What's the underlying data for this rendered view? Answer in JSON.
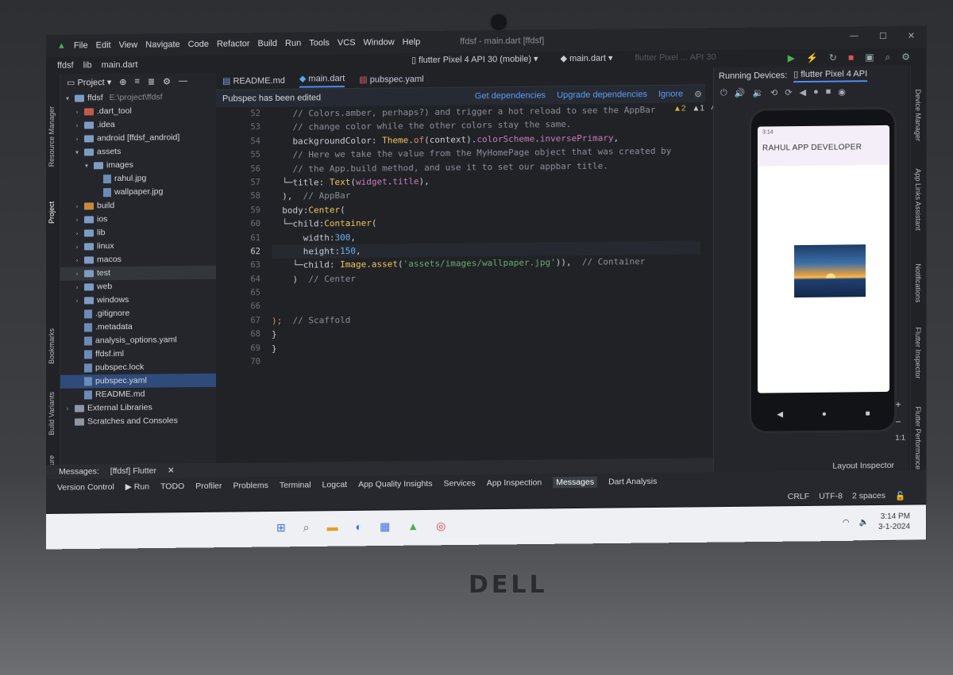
{
  "menu": {
    "items": [
      "File",
      "Edit",
      "View",
      "Navigate",
      "Code",
      "Refactor",
      "Build",
      "Run",
      "Tools",
      "VCS",
      "Window",
      "Help"
    ],
    "window_title": "ffdsf - main.dart [ffdsf]"
  },
  "breadcrumb": [
    "ffdsf",
    "lib",
    "main.dart"
  ],
  "run_config": {
    "device": "flutter Pixel 4 API 30 (mobile)",
    "file": "main.dart",
    "ghost_device": "flutter Pixel ... API 30"
  },
  "left_strip": [
    "Resource Manager",
    "Project",
    "Bookmarks",
    "Build Variants",
    "Structure"
  ],
  "project_panel": {
    "title": "Project",
    "root": "ffdsf",
    "root_path": "E:\\project\\ffdsf",
    "tree": [
      {
        "label": "ffdsf",
        "indent": 0,
        "arrow": "▾",
        "type": "folder"
      },
      {
        "label": ".dart_tool",
        "indent": 1,
        "arrow": "›",
        "type": "folder-red"
      },
      {
        "label": ".idea",
        "indent": 1,
        "arrow": "›",
        "type": "folder"
      },
      {
        "label": "android [ffdsf_android]",
        "indent": 1,
        "arrow": "›",
        "type": "folder"
      },
      {
        "label": "assets",
        "indent": 1,
        "arrow": "▾",
        "type": "folder"
      },
      {
        "label": "images",
        "indent": 2,
        "arrow": "▾",
        "type": "folder"
      },
      {
        "label": "rahul.jpg",
        "indent": 3,
        "arrow": "",
        "type": "file"
      },
      {
        "label": "wallpaper.jpg",
        "indent": 3,
        "arrow": "",
        "type": "file"
      },
      {
        "label": "build",
        "indent": 1,
        "arrow": "›",
        "type": "folder-orange"
      },
      {
        "label": "ios",
        "indent": 1,
        "arrow": "›",
        "type": "folder"
      },
      {
        "label": "lib",
        "indent": 1,
        "arrow": "›",
        "type": "folder"
      },
      {
        "label": "linux",
        "indent": 1,
        "arrow": "›",
        "type": "folder"
      },
      {
        "label": "macos",
        "indent": 1,
        "arrow": "›",
        "type": "folder"
      },
      {
        "label": "test",
        "indent": 1,
        "arrow": "›",
        "type": "folder"
      },
      {
        "label": "web",
        "indent": 1,
        "arrow": "›",
        "type": "folder"
      },
      {
        "label": "windows",
        "indent": 1,
        "arrow": "›",
        "type": "folder"
      },
      {
        "label": ".gitignore",
        "indent": 1,
        "arrow": "",
        "type": "file"
      },
      {
        "label": ".metadata",
        "indent": 1,
        "arrow": "",
        "type": "file"
      },
      {
        "label": "analysis_options.yaml",
        "indent": 1,
        "arrow": "",
        "type": "file"
      },
      {
        "label": "ffdsf.iml",
        "indent": 1,
        "arrow": "",
        "type": "file"
      },
      {
        "label": "pubspec.lock",
        "indent": 1,
        "arrow": "",
        "type": "file"
      },
      {
        "label": "pubspec.yaml",
        "indent": 1,
        "arrow": "",
        "type": "file"
      },
      {
        "label": "README.md",
        "indent": 1,
        "arrow": "",
        "type": "file"
      },
      {
        "label": "External Libraries",
        "indent": 0,
        "arrow": "›",
        "type": "lib"
      },
      {
        "label": "Scratches and Consoles",
        "indent": 0,
        "arrow": "",
        "type": "lib"
      }
    ]
  },
  "editor": {
    "tabs": [
      "README.md",
      "main.dart",
      "pubspec.yaml"
    ],
    "active_tab": "main.dart",
    "banner_text": "Pubspec has been edited",
    "banner_actions": [
      "Get dependencies",
      "Upgrade dependencies",
      "Ignore"
    ],
    "inspections": [
      "▲2",
      "▲1"
    ],
    "line_numbers": [
      "52",
      "53",
      "54",
      "55",
      "56",
      "57",
      "58",
      "59",
      "60",
      "61",
      "62",
      "63",
      "64",
      "65",
      "66",
      "67",
      "68",
      "69",
      "70"
    ],
    "current_line": "62"
  },
  "devices": {
    "title": "Running Devices:",
    "tab": "flutter Pixel 4 API",
    "app_title": "RAHUL APP DEVELOPER",
    "zoom_label": "1:1",
    "status_time": "3:14"
  },
  "right_strip": [
    "Device Manager",
    "App Links Assistant",
    "Notifications",
    "Flutter Inspector",
    "Flutter Performance"
  ],
  "messages_bar": [
    "Messages:",
    "[ffdsf] Flutter"
  ],
  "bottom_tools": [
    "Version Control",
    "Run",
    "TODO",
    "Profiler",
    "Problems",
    "Terminal",
    "Logcat",
    "App Quality Insights",
    "Services",
    "App Inspection",
    "Messages",
    "Dart Analysis"
  ],
  "active_bottom_tool": "Messages",
  "layout_inspector": "Layout Inspector",
  "status": {
    "line_sep": "CRLF",
    "encoding": "UTF-8",
    "indent": "2 spaces"
  },
  "taskbar": {
    "time": "3:14 PM",
    "date": "3-1-2024"
  },
  "colors": {
    "accent": "#4d8cf5",
    "panel": "#24262b",
    "editor_bg": "#202226",
    "selection": "#2f4b7b"
  }
}
